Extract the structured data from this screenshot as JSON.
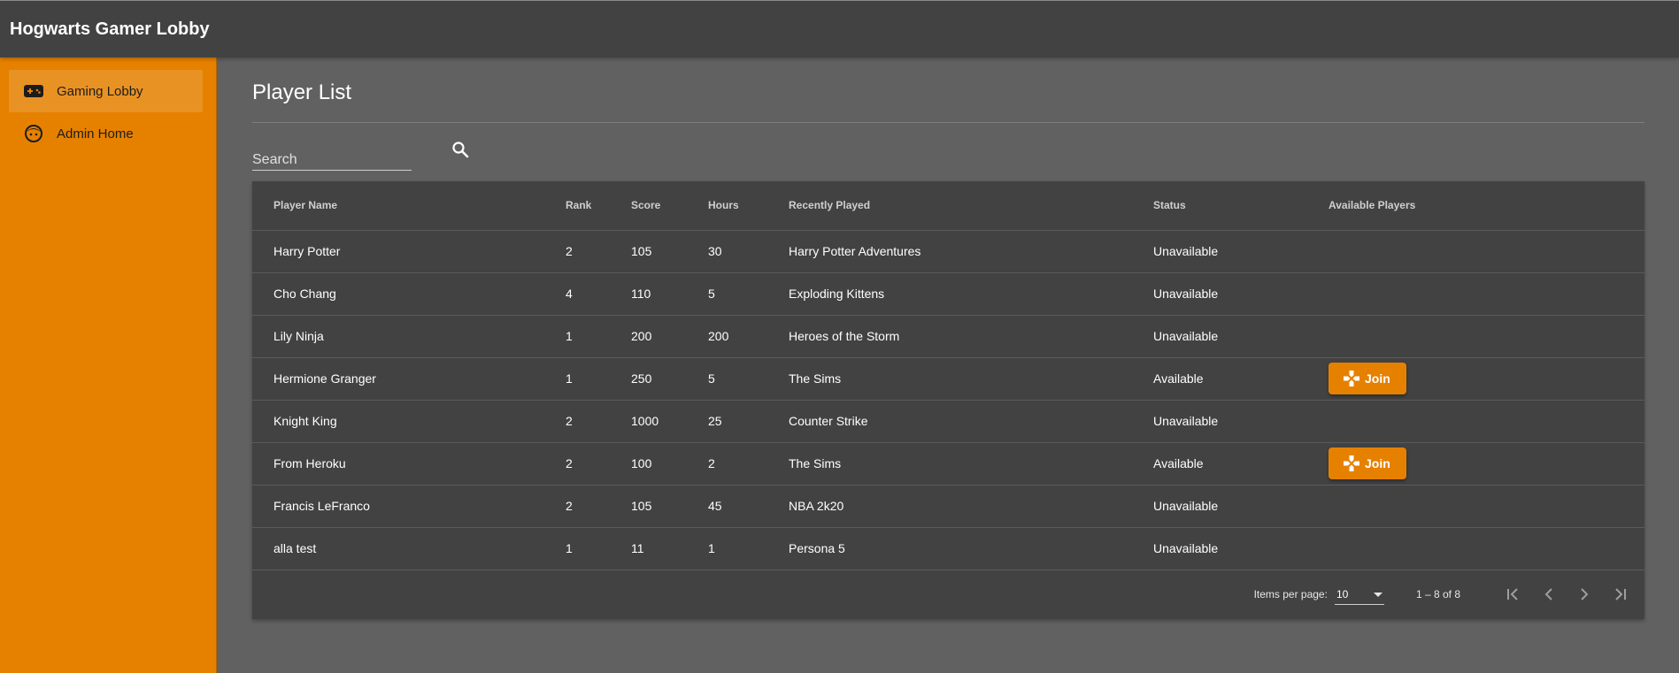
{
  "app": {
    "title": "Hogwarts Gamer Lobby"
  },
  "sidebar": {
    "items": [
      {
        "label": "Gaming Lobby",
        "icon": "gamepad-icon",
        "active": true
      },
      {
        "label": "Admin Home",
        "icon": "face-icon",
        "active": false
      }
    ]
  },
  "main": {
    "title": "Player List",
    "search": {
      "placeholder": "Search",
      "value": ""
    }
  },
  "table": {
    "columns": [
      "Player Name",
      "Rank",
      "Score",
      "Hours",
      "Recently Played",
      "Status",
      "Available Players"
    ],
    "rows": [
      {
        "name": "Harry Potter",
        "rank": "2",
        "score": "105",
        "hours": "30",
        "recent": "Harry Potter Adventures",
        "status": "Unavailable",
        "join": false
      },
      {
        "name": "Cho Chang",
        "rank": "4",
        "score": "110",
        "hours": "5",
        "recent": "Exploding Kittens",
        "status": "Unavailable",
        "join": false
      },
      {
        "name": "Lily Ninja",
        "rank": "1",
        "score": "200",
        "hours": "200",
        "recent": "Heroes of the Storm",
        "status": "Unavailable",
        "join": false
      },
      {
        "name": "Hermione Granger",
        "rank": "1",
        "score": "250",
        "hours": "5",
        "recent": "The Sims",
        "status": "Available",
        "join": true
      },
      {
        "name": "Knight King",
        "rank": "2",
        "score": "1000",
        "hours": "25",
        "recent": "Counter Strike",
        "status": "Unavailable",
        "join": false
      },
      {
        "name": "From Heroku",
        "rank": "2",
        "score": "100",
        "hours": "2",
        "recent": "The Sims",
        "status": "Available",
        "join": true
      },
      {
        "name": "Francis LeFranco",
        "rank": "2",
        "score": "105",
        "hours": "45",
        "recent": "NBA 2k20",
        "status": "Unavailable",
        "join": false
      },
      {
        "name": "alla test",
        "rank": "1",
        "score": "11",
        "hours": "1",
        "recent": "Persona 5",
        "status": "Unavailable",
        "join": false
      }
    ],
    "join_label": "Join"
  },
  "paginator": {
    "items_per_page_label": "Items per page:",
    "items_per_page": "10",
    "range": "1 – 8 of 8"
  },
  "colors": {
    "accent": "#e68100",
    "toolbar": "#424242",
    "background": "#616161",
    "card": "#424242"
  }
}
